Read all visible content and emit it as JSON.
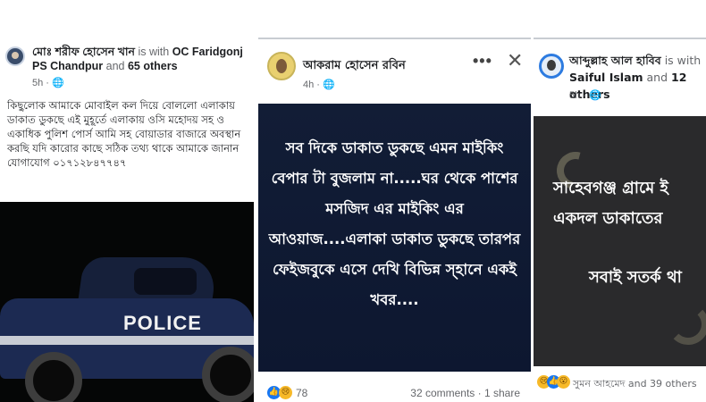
{
  "post1": {
    "author": "মোঃ শরীফ হোসেন খান",
    "with_text": " is with ",
    "tagged": "OC Faridgonj PS Chandpur",
    "and_text": " and ",
    "others": "65 others",
    "time": "5h ·",
    "body": "কিছুলোক আমাকে মোবাইল কল দিয়ে বোললো এলাকায় ডাকাত ডুকছে এই মুহূর্তে এলাকায় ওসি মহোদয় সহ ও একাধিক পুলিশ পোর্স আমি সহ বোয়াডার বাজারে অবস্থান করছি যদি কারোর কাছে সঠিক তথ্য থাকে আমাকে জানান যোগাযোগ ০১৭১২৮৪৭৭৪৭",
    "photo_text": "POLICE"
  },
  "post2": {
    "author": "আকরাম হোসেন রবিন",
    "time": "4h ·",
    "more": "•••",
    "close": "✕",
    "banner_text": "সব দিকে ডাকাত ডুকছে এমন মাইকিং বেপার টা বুজলাম না.....ঘর থেকে পাশের মসজিদ এর মাইকিং এর আওয়াজ....এলাকা ডাকাত ডুকছে তারপর ফেইজবুকে এসে দেখি বিভিন্ন স্হানে একই খবর....",
    "reaction_count": "78",
    "stats": "32 comments · 1 share"
  },
  "post3": {
    "author": "আব্দুল্লাহ আল হাবিব",
    "with_text": " is with ",
    "tagged": "Saiful Islam",
    "and_text": " and ",
    "others": "12 others",
    "time": "5h ·",
    "banner_line1": "সাহেবগঞ্জ গ্রামে ই",
    "banner_line2": "একদল ডাকাতের",
    "banner_line3": "সবাই সতর্ক থা",
    "reaction_text": "সুমন আহমেদ and 39 others"
  }
}
